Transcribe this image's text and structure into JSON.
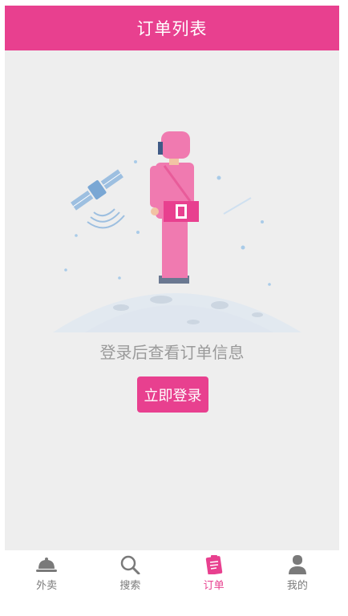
{
  "header": {
    "title": "订单列表"
  },
  "empty_state": {
    "illustration_icon": "astronaut-on-moon-illustration",
    "message": "登录后查看订单信息",
    "login_button_label": "立即登录"
  },
  "tabbar": {
    "items": [
      {
        "label": "外卖",
        "icon": "cloche-icon",
        "active": false
      },
      {
        "label": "搜索",
        "icon": "search-icon",
        "active": false
      },
      {
        "label": "订单",
        "icon": "order-clipboard-icon",
        "active": true
      },
      {
        "label": "我的",
        "icon": "user-icon",
        "active": false
      }
    ]
  },
  "colors": {
    "brand": "#e8408f",
    "background": "#eeeeee",
    "inactive_tab": "#7a7a7a",
    "message_text": "#9a9a9a"
  }
}
